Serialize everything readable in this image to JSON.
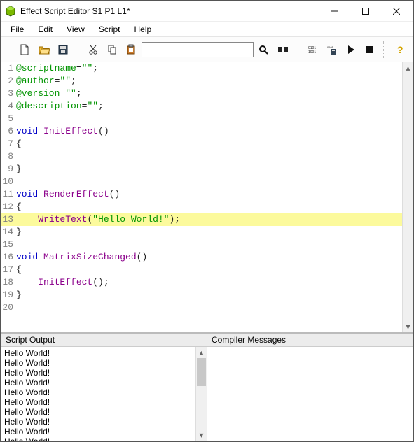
{
  "window": {
    "title": "Effect Script Editor S1 P1 L1*"
  },
  "menu": {
    "file": "File",
    "edit": "Edit",
    "view": "View",
    "script": "Script",
    "help": "Help"
  },
  "toolbar": {
    "search_placeholder": ""
  },
  "code": {
    "lines": [
      {
        "n": 1,
        "tokens": [
          [
            "meta",
            "@scriptname"
          ],
          [
            "punc",
            "="
          ],
          [
            "str",
            "\"\""
          ],
          [
            "punc",
            ";"
          ]
        ]
      },
      {
        "n": 2,
        "tokens": [
          [
            "meta",
            "@author"
          ],
          [
            "punc",
            "="
          ],
          [
            "str",
            "\"\""
          ],
          [
            "punc",
            ";"
          ]
        ]
      },
      {
        "n": 3,
        "tokens": [
          [
            "meta",
            "@version"
          ],
          [
            "punc",
            "="
          ],
          [
            "str",
            "\"\""
          ],
          [
            "punc",
            ";"
          ]
        ]
      },
      {
        "n": 4,
        "tokens": [
          [
            "meta",
            "@description"
          ],
          [
            "punc",
            "="
          ],
          [
            "str",
            "\"\""
          ],
          [
            "punc",
            ";"
          ]
        ]
      },
      {
        "n": 5,
        "tokens": []
      },
      {
        "n": 6,
        "tokens": [
          [
            "kw",
            "void"
          ],
          [
            "plain",
            " "
          ],
          [
            "fn",
            "InitEffect"
          ],
          [
            "punc",
            "()"
          ]
        ]
      },
      {
        "n": 7,
        "tokens": [
          [
            "punc",
            "{"
          ]
        ]
      },
      {
        "n": 8,
        "tokens": []
      },
      {
        "n": 9,
        "tokens": [
          [
            "punc",
            "}"
          ]
        ]
      },
      {
        "n": 10,
        "tokens": []
      },
      {
        "n": 11,
        "tokens": [
          [
            "kw",
            "void"
          ],
          [
            "plain",
            " "
          ],
          [
            "fn",
            "RenderEffect"
          ],
          [
            "punc",
            "()"
          ]
        ]
      },
      {
        "n": 12,
        "tokens": [
          [
            "punc",
            "{"
          ]
        ]
      },
      {
        "n": 13,
        "hl": true,
        "tokens": [
          [
            "plain",
            "    "
          ],
          [
            "fn",
            "WriteText"
          ],
          [
            "punc",
            "("
          ],
          [
            "str",
            "\"Hello World!\""
          ],
          [
            "punc",
            ");"
          ]
        ]
      },
      {
        "n": 14,
        "tokens": [
          [
            "punc",
            "}"
          ]
        ]
      },
      {
        "n": 15,
        "tokens": []
      },
      {
        "n": 16,
        "tokens": [
          [
            "kw",
            "void"
          ],
          [
            "plain",
            " "
          ],
          [
            "fn",
            "MatrixSizeChanged"
          ],
          [
            "punc",
            "()"
          ]
        ]
      },
      {
        "n": 17,
        "tokens": [
          [
            "punc",
            "{"
          ]
        ]
      },
      {
        "n": 18,
        "tokens": [
          [
            "plain",
            "    "
          ],
          [
            "fn",
            "InitEffect"
          ],
          [
            "punc",
            "();"
          ]
        ]
      },
      {
        "n": 19,
        "tokens": [
          [
            "punc",
            "}"
          ]
        ]
      },
      {
        "n": 20,
        "tokens": []
      }
    ]
  },
  "panels": {
    "output_label": "Script Output",
    "compiler_label": "Compiler Messages",
    "output_lines": [
      "Hello World!",
      "Hello World!",
      "Hello World!",
      "Hello World!",
      "Hello World!",
      "Hello World!",
      "Hello World!",
      "Hello World!",
      "Hello World!",
      "Hello World!"
    ]
  }
}
